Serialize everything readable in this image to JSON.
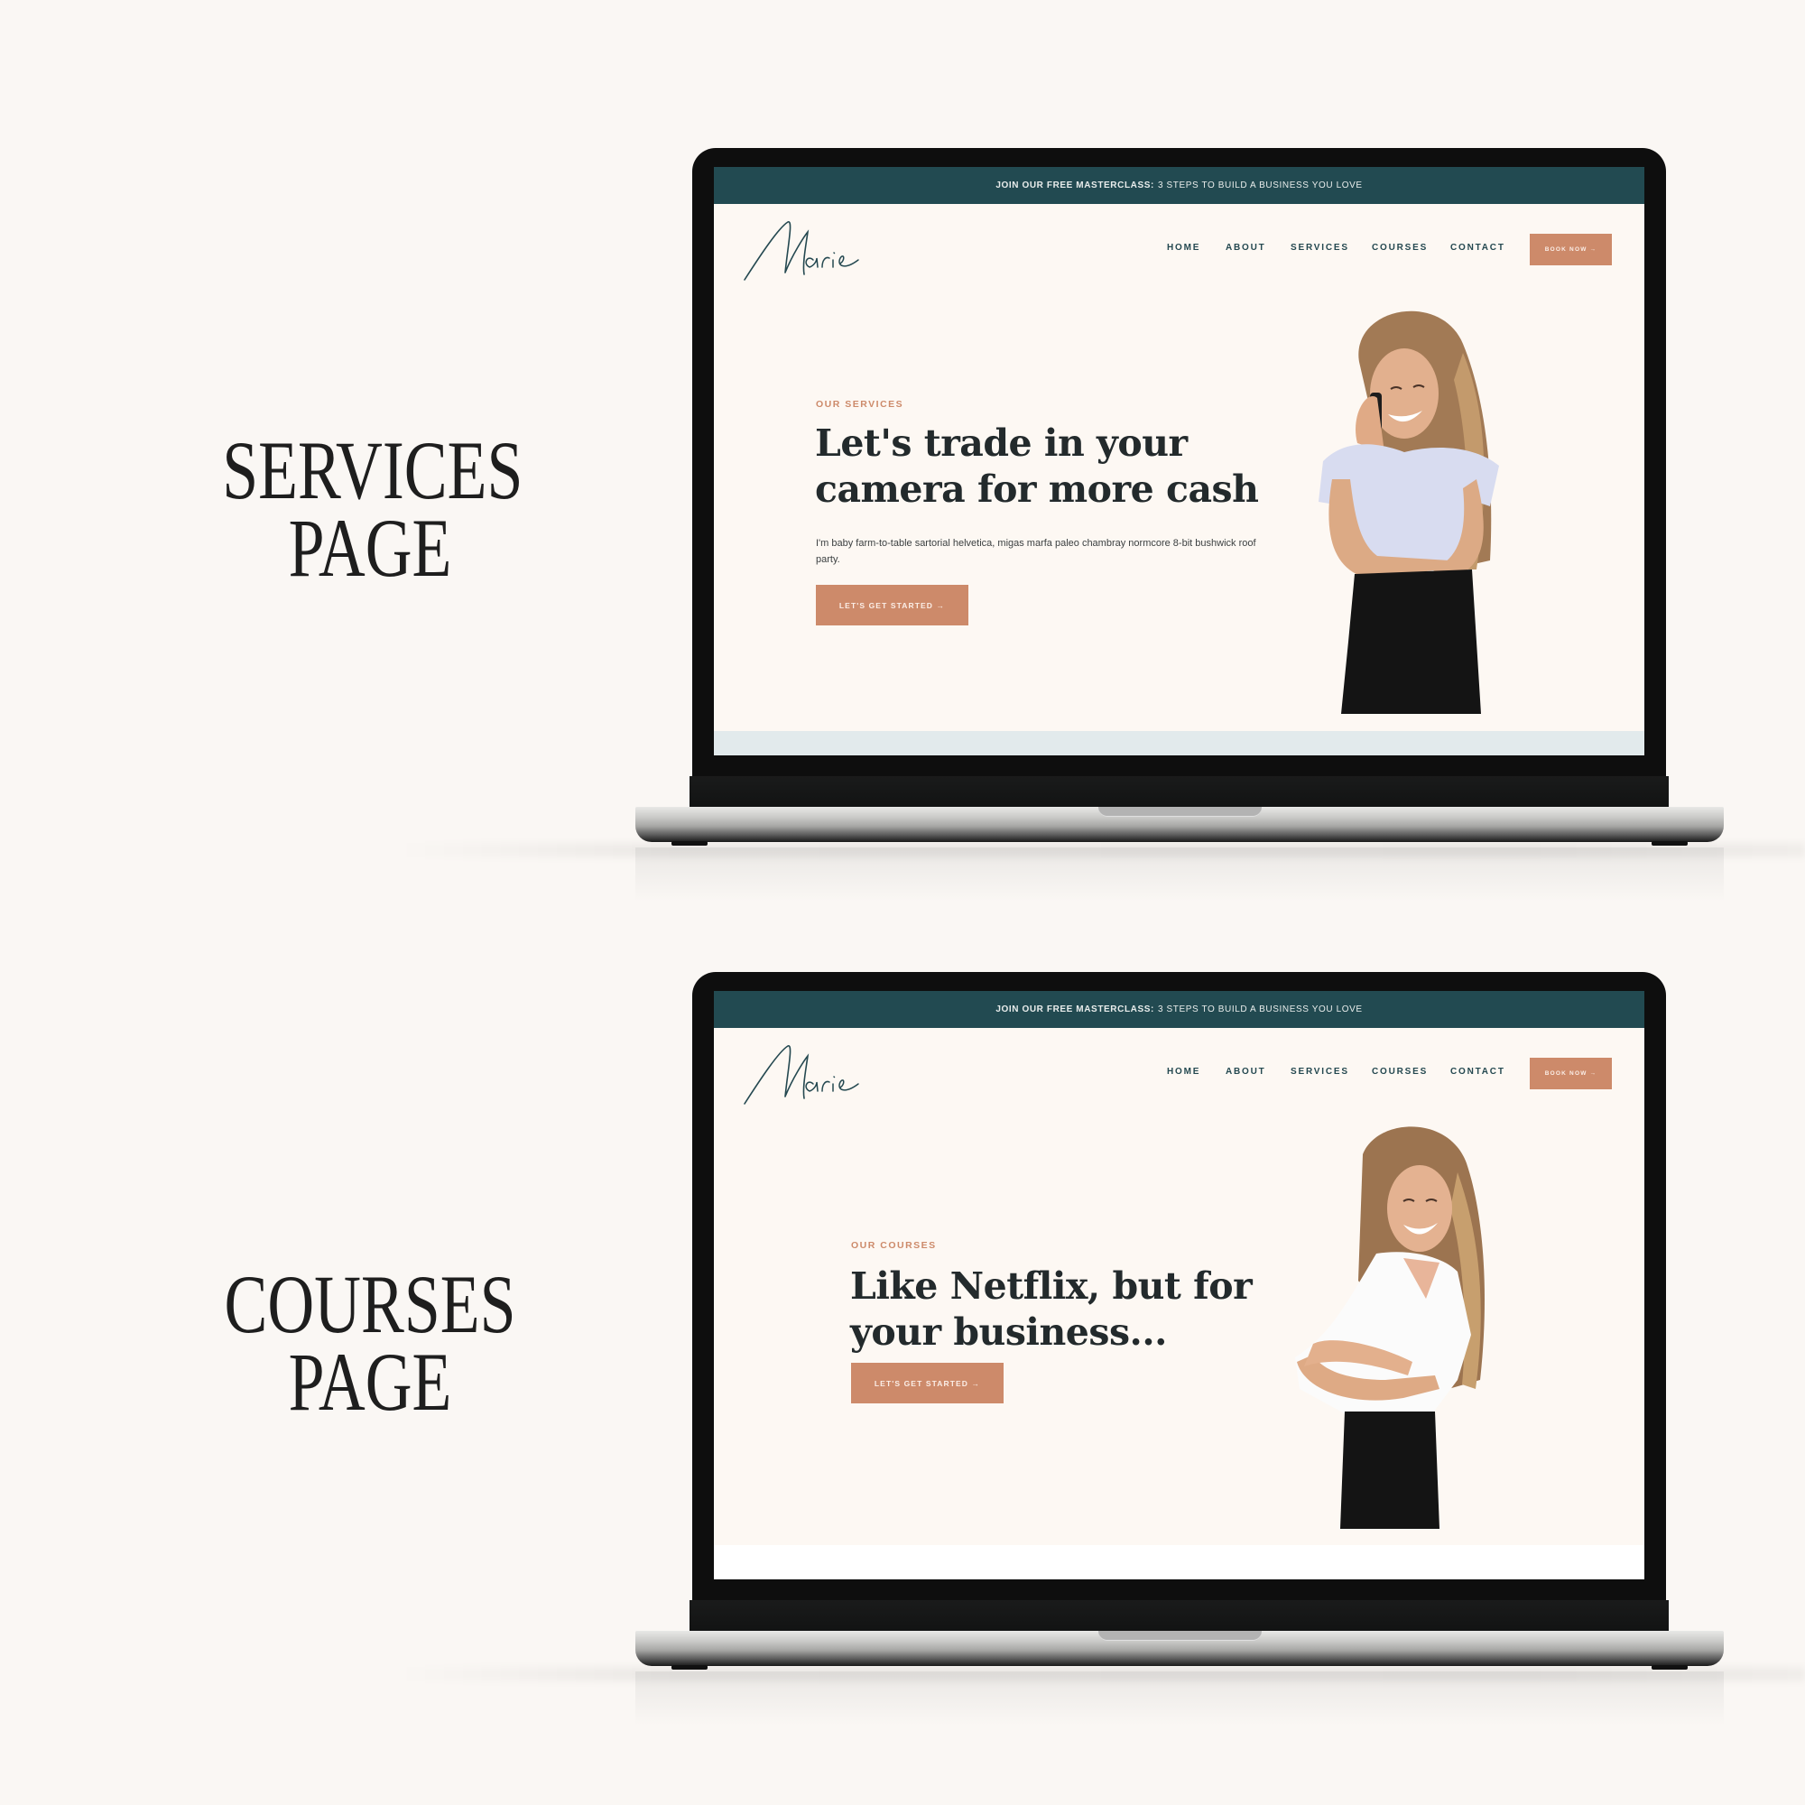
{
  "colors": {
    "background": "#faf7f4",
    "banner": "#224a51",
    "accent": "#cd8a6a",
    "nav_text": "#244850",
    "heading_text": "#232a2c",
    "screen_bg": "#fdf8f3"
  },
  "mockups": [
    {
      "side_title": [
        "SERVICES",
        "PAGE"
      ],
      "banner": {
        "bold": "JOIN OUR FREE MASTERCLASS:",
        "text": "3 STEPS TO BUILD A BUSINESS YOU LOVE"
      },
      "logo": "Marie",
      "nav": [
        "HOME",
        "ABOUT",
        "SERVICES",
        "COURSES",
        "CONTACT"
      ],
      "book_button": "BOOK NOW →",
      "eyebrow": "OUR SERVICES",
      "headline": [
        "Let's trade in your",
        "camera for more cash"
      ],
      "body": "I'm baby farm-to-table sartorial helvetica, migas marfa paleo chambray normcore 8-bit bushwick roof party.",
      "cta": "LET'S GET STARTED →",
      "hero_image": "woman-on-phone-photo"
    },
    {
      "side_title": [
        "COURSES",
        "PAGE"
      ],
      "banner": {
        "bold": "JOIN OUR FREE MASTERCLASS:",
        "text": "3 STEPS TO BUILD A BUSINESS YOU LOVE"
      },
      "logo": "Marie",
      "nav": [
        "HOME",
        "ABOUT",
        "SERVICES",
        "COURSES",
        "CONTACT"
      ],
      "book_button": "BOOK NOW →",
      "eyebrow": "OUR COURSES",
      "headline": [
        "Like Netflix, but for",
        "your business..."
      ],
      "cta": "LET'S GET STARTED →",
      "hero_image": "woman-arms-crossed-photo"
    }
  ]
}
